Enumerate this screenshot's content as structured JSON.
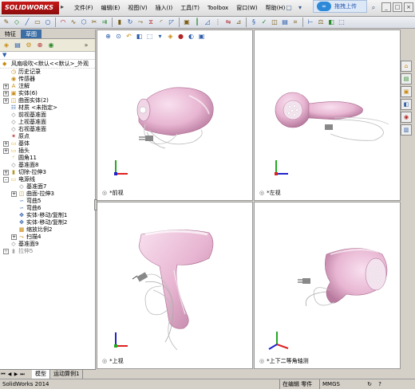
{
  "app": {
    "logo_text": "SOLIDWORKS",
    "upload_label": "拖拽上传",
    "upload_icon_text": "∞"
  },
  "menu": [
    "文件(F)",
    "编辑(E)",
    "视图(V)",
    "插入(I)",
    "工具(T)",
    "Toolbox",
    "窗口(W)",
    "帮助(H)"
  ],
  "panel": {
    "tabs": [
      "特征",
      "草图"
    ],
    "root_label": "风扇吸吹<默认<<默认>_外观",
    "tree": [
      {
        "label": "历史记录",
        "icon": "history-icon",
        "level": 0,
        "expand": ""
      },
      {
        "label": "传感器",
        "icon": "sensor-icon",
        "level": 0,
        "expand": ""
      },
      {
        "label": "注解",
        "icon": "annotation-icon",
        "level": 0,
        "expand": "+"
      },
      {
        "label": "实体(6)",
        "icon": "solid-bodies-icon",
        "level": 0,
        "expand": "+"
      },
      {
        "label": "曲面实体(2)",
        "icon": "surface-bodies-icon",
        "level": 0,
        "expand": "+"
      },
      {
        "label": "材质 <未指定>",
        "icon": "material-icon",
        "level": 0,
        "expand": ""
      },
      {
        "label": "前视基准面",
        "icon": "plane-icon",
        "level": 0,
        "expand": ""
      },
      {
        "label": "上视基准面",
        "icon": "plane-icon",
        "level": 0,
        "expand": ""
      },
      {
        "label": "右视基准面",
        "icon": "plane-icon",
        "level": 0,
        "expand": ""
      },
      {
        "label": "原点",
        "icon": "origin-icon",
        "level": 0,
        "expand": ""
      },
      {
        "label": "基体",
        "icon": "folder-icon",
        "level": 0,
        "expand": "+"
      },
      {
        "label": "插头",
        "icon": "folder-icon",
        "level": 0,
        "expand": "+"
      },
      {
        "label": "圆角11",
        "icon": "fillet-icon",
        "level": 0,
        "expand": ""
      },
      {
        "label": "基准面8",
        "icon": "plane-icon",
        "level": 0,
        "expand": ""
      },
      {
        "label": "切除-拉伸3",
        "icon": "cut-extrude-icon",
        "level": 0,
        "expand": "+"
      },
      {
        "label": "电源线",
        "icon": "folder-open-icon",
        "level": 0,
        "expand": "-"
      },
      {
        "label": "基准面7",
        "icon": "plane-icon",
        "level": 1,
        "expand": ""
      },
      {
        "label": "曲面-拉伸3",
        "icon": "surface-extrude-icon",
        "level": 1,
        "expand": "+"
      },
      {
        "label": "弯曲5",
        "icon": "flex-icon",
        "level": 1,
        "expand": ""
      },
      {
        "label": "弯曲6",
        "icon": "flex-icon",
        "level": 1,
        "expand": ""
      },
      {
        "label": "实体-移动/复制1",
        "icon": "move-copy-icon",
        "level": 1,
        "expand": ""
      },
      {
        "label": "实体-移动/复制2",
        "icon": "move-copy-icon",
        "level": 1,
        "expand": ""
      },
      {
        "label": "缩放比例2",
        "icon": "scale-icon",
        "level": 1,
        "expand": ""
      },
      {
        "label": "扫描4",
        "icon": "sweep-icon",
        "level": 1,
        "expand": "+"
      },
      {
        "label": "基准面9",
        "icon": "plane-icon",
        "level": 0,
        "expand": ""
      },
      {
        "label": "拉伸5",
        "icon": "extrude-icon",
        "level": 0,
        "expand": "+",
        "greyed": true
      }
    ],
    "bottom_tabs": [
      "模型",
      "运动算例1"
    ]
  },
  "viewports": [
    {
      "name": "viewport-front",
      "label": "*前视"
    },
    {
      "name": "viewport-left",
      "label": "*左视"
    },
    {
      "name": "viewport-top",
      "label": "*上视"
    },
    {
      "name": "viewport-dimetric",
      "label": "*上下二等角轴测"
    }
  ],
  "status": {
    "app_version": "SolidWorks 2014",
    "mode": "在编辑 零件",
    "units": "MMGS"
  },
  "colors": {
    "body_pink": "#e8b6d2",
    "body_dark": "#c88aae",
    "axis_x": "#d22",
    "axis_y": "#2a2",
    "axis_z": "#22c"
  }
}
